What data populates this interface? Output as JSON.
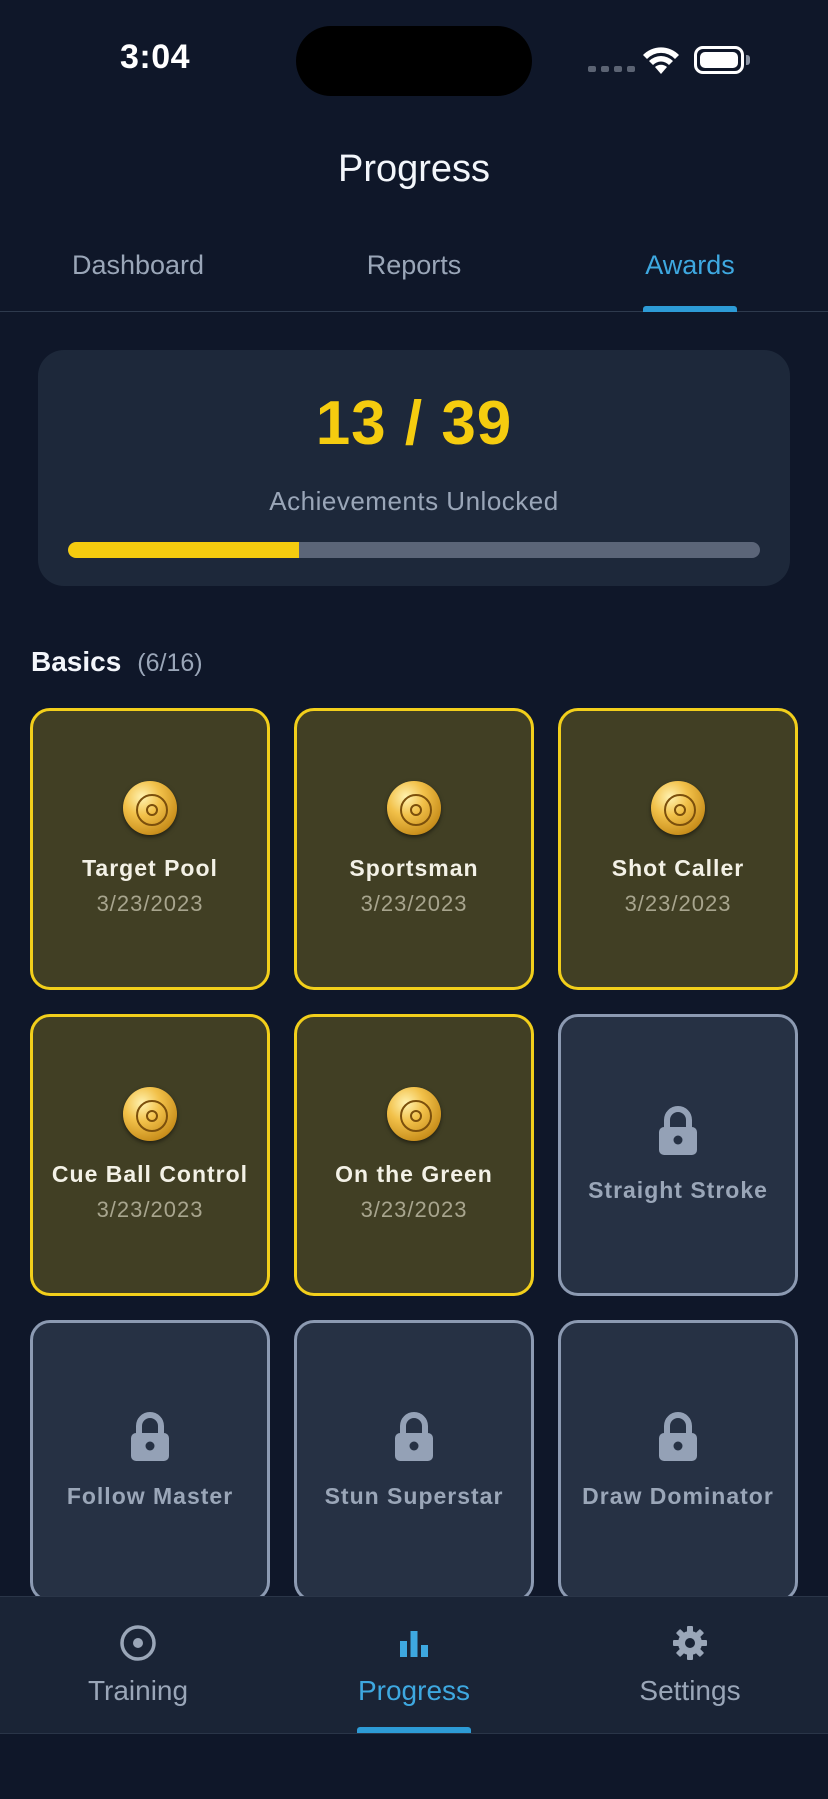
{
  "status_bar": {
    "time": "3:04"
  },
  "header": {
    "title": "Progress"
  },
  "top_tabs": [
    {
      "label": "Dashboard",
      "active": false
    },
    {
      "label": "Reports",
      "active": false
    },
    {
      "label": "Awards",
      "active": true
    }
  ],
  "summary": {
    "count": "13 / 39",
    "label": "Achievements Unlocked",
    "progress_fraction": 0.3333
  },
  "section": {
    "title": "Basics",
    "count": "(6/16)"
  },
  "achievements": [
    {
      "name": "Target Pool",
      "date": "3/23/2023",
      "unlocked": true,
      "icon": "medal-icon"
    },
    {
      "name": "Sportsman",
      "date": "3/23/2023",
      "unlocked": true,
      "icon": "medal-icon"
    },
    {
      "name": "Shot Caller",
      "date": "3/23/2023",
      "unlocked": true,
      "icon": "medal-icon"
    },
    {
      "name": "Cue Ball Control",
      "date": "3/23/2023",
      "unlocked": true,
      "icon": "medal-icon"
    },
    {
      "name": "On the Green",
      "date": "3/23/2023",
      "unlocked": true,
      "icon": "medal-icon"
    },
    {
      "name": "Straight Stroke",
      "date": "",
      "unlocked": false,
      "icon": "lock-icon"
    },
    {
      "name": "Follow Master",
      "date": "",
      "unlocked": false,
      "icon": "lock-icon"
    },
    {
      "name": "Stun Superstar",
      "date": "",
      "unlocked": false,
      "icon": "lock-icon"
    },
    {
      "name": "Draw Dominator",
      "date": "",
      "unlocked": false,
      "icon": "lock-icon"
    }
  ],
  "bottom_nav": [
    {
      "label": "Training",
      "icon": "target-icon",
      "active": false
    },
    {
      "label": "Progress",
      "icon": "bar-chart-icon",
      "active": true
    },
    {
      "label": "Settings",
      "icon": "gear-icon",
      "active": false
    }
  ],
  "colors": {
    "background": "#0f1729",
    "accent": "#3ea8e0",
    "gold": "#f5cc0f",
    "locked_border": "#8c9ab2"
  }
}
